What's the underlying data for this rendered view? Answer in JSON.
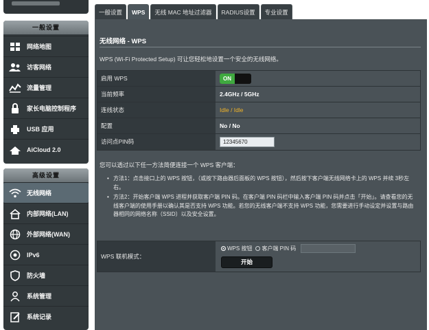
{
  "sidebar": {
    "general_header": "一般设置",
    "general_items": [
      {
        "label": "网络地图",
        "icon": "network-map-icon"
      },
      {
        "label": "访客网络",
        "icon": "guest-network-icon"
      },
      {
        "label": "流量管理",
        "icon": "traffic-manager-icon"
      },
      {
        "label": "家长电脑控制程序",
        "icon": "parental-control-icon"
      },
      {
        "label": "USB 应用",
        "icon": "usb-application-icon"
      },
      {
        "label": "AiCloud 2.0",
        "icon": "aicloud-icon"
      }
    ],
    "advanced_header": "高级设置",
    "advanced_items": [
      {
        "label": "无线网络",
        "icon": "wireless-icon",
        "active": true
      },
      {
        "label": "内部网络(LAN)",
        "icon": "lan-icon"
      },
      {
        "label": "外部网络(WAN)",
        "icon": "wan-icon"
      },
      {
        "label": "IPv6",
        "icon": "ipv6-icon"
      },
      {
        "label": "防火墙",
        "icon": "firewall-icon"
      },
      {
        "label": "系统管理",
        "icon": "administration-icon"
      },
      {
        "label": "系统记录",
        "icon": "system-log-icon"
      }
    ]
  },
  "tabs": [
    {
      "label": "一般设置"
    },
    {
      "label": "WPS",
      "active": true
    },
    {
      "label": "无线 MAC 地址过滤器"
    },
    {
      "label": "RADIUS设置"
    },
    {
      "label": "专业设置"
    }
  ],
  "page": {
    "title": "无线网络 - WPS",
    "description": "WPS (Wi-Fi Protected Setup) 可让您轻松地设置一个安全的无线网络。"
  },
  "settings": {
    "enable_wps_label": "启用 WPS",
    "enable_wps_state": "ON",
    "frequency_label": "当前频率",
    "frequency_value": "2.4GHz / 5GHz",
    "connection_status_label": "连线状态",
    "connection_status_value": "Idle / Idle",
    "configured_label": "配置",
    "configured_value": "No / No",
    "ap_pin_label": "访问点PIN码",
    "ap_pin_value": "12345670"
  },
  "instructions": {
    "intro": "您可以透过以下任一方法简便连接一个 WPS 客户端：",
    "method1": "方法1：点击接口上的 WPS 按钮，（或按下路由器后面板的 WPS 按钮），然后按下客户端无线网络卡上的 WPS 并续 3秒左右。",
    "method2": "方法2：开始客户端 WPS 进程并获取客户端 PIN 码。在客户端 PIN 码栏中输入客户端 PIN 码并点击「开始」。请查看您的无线客户端的使用手册以确认其是否支持 WPS 功能。若您的无线客户端不支持 WPS 功能，您需要进行手动设定并设置与路由器相同的网络名称（SSID）以及安全设置。"
  },
  "wps_mode": {
    "label": "WPS 联机模式：",
    "option_button": "WPS 按钮",
    "option_client_pin": "客户端 PIN 码",
    "selected": "WPS 按钮",
    "start_button": "开始"
  },
  "colors": {
    "panel": "#4a5257",
    "toggle_on": "#3fa93f",
    "status_text": "#f0b429",
    "sidebar_active": "#5b6a73"
  }
}
